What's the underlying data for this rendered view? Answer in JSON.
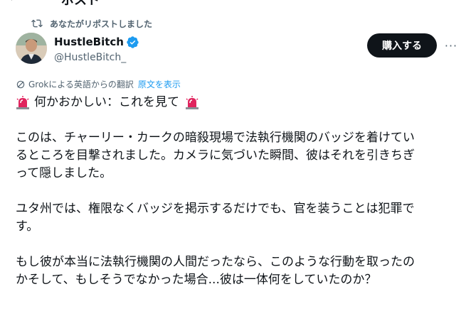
{
  "header": {
    "back_icon": "arrow-left-icon",
    "title": "ポスト"
  },
  "repost": {
    "icon": "repost-icon",
    "text": "あなたがリポストしました"
  },
  "author": {
    "name": "HustleBitch",
    "handle": "@HustleBitch_",
    "verified_icon": "verified-badge-icon",
    "verified_color": "#1d9bf0"
  },
  "actions": {
    "buy_label": "購入する",
    "more_icon": "more-icon",
    "more_label": "···"
  },
  "translation": {
    "icon": "grok-icon",
    "label": "Grokによる英語からの翻訳",
    "show_original": "原文を表示"
  },
  "tweet": {
    "headline_emoji": "siren-icon",
    "headline": "何かおかしい：これを見て",
    "line1": "このは、チャーリー・カークの暗殺現場で法執行機関のバッジを着けてい",
    "line2": "るところを目撃されました。カメラに気づいた瞬間、彼はそれを引きちぎ",
    "line3": "って隠しました。",
    "line4": "ユタ州では、権限なくバッジを掲示するだけでも、官を装うことは犯罪で",
    "line5": "す。",
    "line6": "もし彼が本当に法執行機関の人間だったなら、このような行動を取ったの",
    "line7": "かそして、もしそうでなかった場合...彼は一体何をしていたのか？"
  },
  "colors": {
    "text": "#0f1419",
    "secondary": "#536471",
    "link": "#1d9bf0",
    "button_bg": "#0f1419"
  }
}
